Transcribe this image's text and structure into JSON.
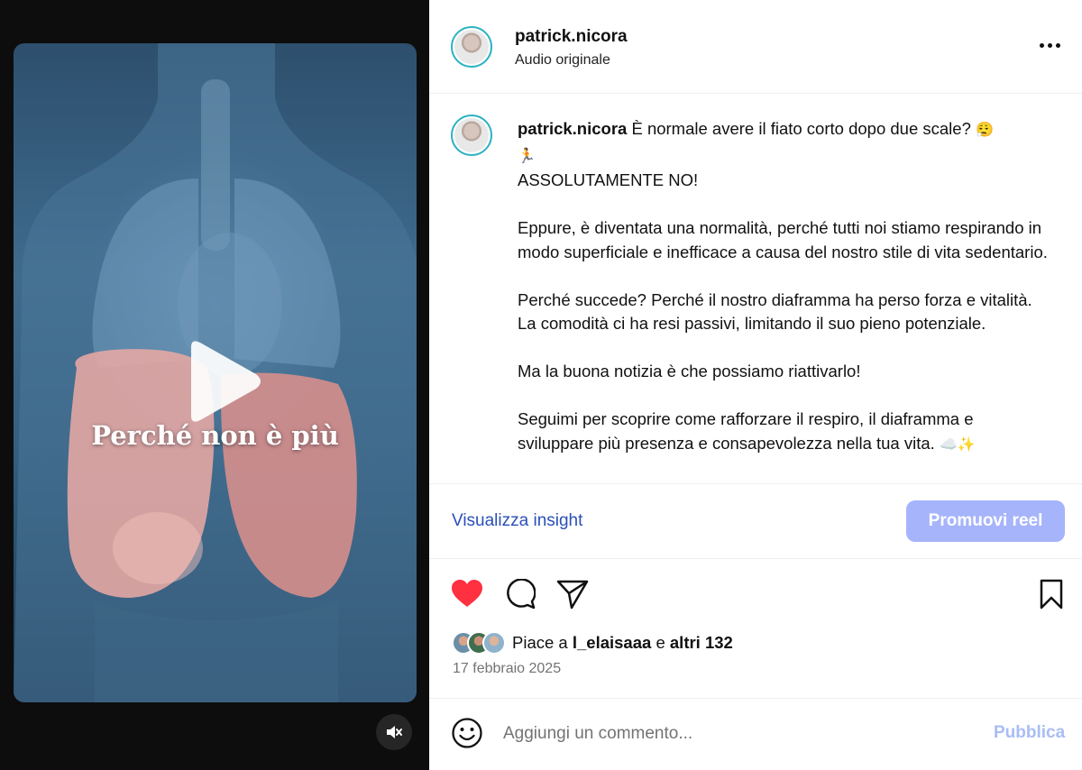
{
  "video": {
    "overlay_text": "Perché non è più"
  },
  "header": {
    "username": "patrick.nicora",
    "audio": "Audio originale"
  },
  "caption": {
    "username": "patrick.nicora",
    "line1": "È normale avere il fiato corto dopo due scale?",
    "line1_emoji": "😮‍💨",
    "line2_emoji": "🏃",
    "p2": "ASSOLUTAMENTE NO!",
    "p3": "Eppure, è diventata una normalità, perché tutti noi stiamo respirando in modo superficiale e inefficace a causa del nostro stile di vita sedentario.",
    "p4": "Perché succede? Perché il nostro diaframma ha perso forza e vitalità. La comodità ci ha resi passivi, limitando il suo pieno potenziale.",
    "p5": "Ma la buona notizia è che possiamo riattivarlo!",
    "p6": "Seguimi per scoprire come rafforzare il respiro, il diaframma e sviluppare più presenza e consapevolezza nella tua vita.",
    "p6_emoji": "☁️✨"
  },
  "insights": {
    "link": "Visualizza insight",
    "promote": "Promuovi reel"
  },
  "likes": {
    "prefix": "Piace a",
    "user": "l_elaisaaa",
    "conj": "e",
    "others": "altri 132"
  },
  "date": "17 febbraio 2025",
  "comment": {
    "placeholder": "Aggiungi un commento...",
    "publish": "Pubblica"
  },
  "colors": {
    "accent_link": "#2a4fb8",
    "promote_bg": "#a6b4fb",
    "like_red": "#ff3040",
    "publish_disabled": "#a9bcf5"
  }
}
